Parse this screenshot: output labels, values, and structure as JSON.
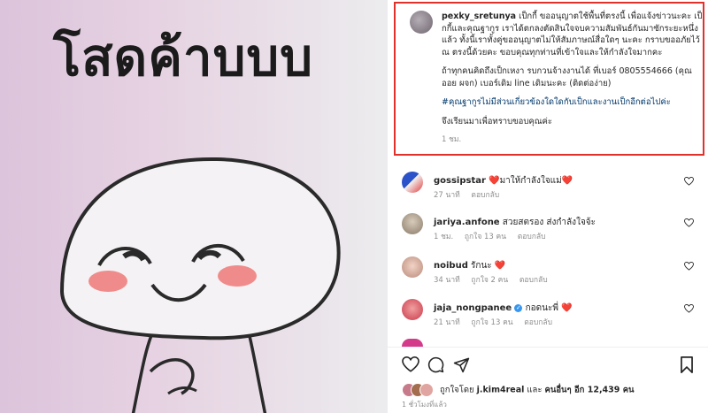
{
  "image": {
    "text": "โสดค้าบบบ"
  },
  "caption": {
    "username": "pexky_sretunya",
    "paragraphs": [
      "เป็กกี้ ขออนุญาตใช้พื้นที่ตรงนี้ เพื่อแจ้งข่าวนะคะ เป็กกี้และคุณฐากูร เราได้ตกลงตัดสินใจจบความสัมพันธ์กันมาซักระยะหนึ่งแล้ว ทั้งนี้เราทั้งคู่ขออนุญาตไม่ให้สัมภาษณ์สื่อใดๆ นะคะ กราบขออภัยไว้ ณ ตรงนี้ด้วยคะ ขอบคุณทุกท่านที่เข้าใจและให้กำลังใจมากคะ",
      "ถ้าทุกคนคิดถึงเป็กเหงา รบกวนจ้างงานได้ ที่เบอร์ 0805554666 (คุณออย ผจก) เบอร์เดิม line เดิมนะคะ (ติดต่อง่าย)"
    ],
    "tags": "#คุณฐากูรไม่มีส่วนเกี่ยวข้องใดใดกับเป็กและงานเป็กอีกต่อไปค่ะ",
    "closing": "จึงเรียนมาเพื่อทราบขอบคุณค่ะ",
    "time": "1 ชม."
  },
  "comments": [
    {
      "username": "gossipstar",
      "text": "❤️มาให้กำลังใจแม่❤️",
      "time": "27 นาที",
      "likes": "",
      "reply": "ตอบกลับ",
      "verified": false
    },
    {
      "username": "jariya.anfone",
      "text": "สวยสตรอง ส่งกำลังใจจ้ะ",
      "time": "1 ชม.",
      "likes": "ถูกใจ 13 คน",
      "reply": "ตอบกลับ",
      "verified": false
    },
    {
      "username": "noibud",
      "text": "รักนะ ❤️",
      "time": "34 นาที",
      "likes": "ถูกใจ 2 คน",
      "reply": "ตอบกลับ",
      "verified": false
    },
    {
      "username": "jaja_nongpanee",
      "text": "กอดนะพี่ ❤️",
      "time": "21 นาที",
      "likes": "ถูกใจ 13 คน",
      "reply": "ตอบกลับ",
      "verified": true
    }
  ],
  "actions": {
    "like": "heart-icon",
    "comment": "comment-icon",
    "share": "share-icon",
    "save": "bookmark-icon"
  },
  "likes": {
    "prefix": "ถูกใจโดย",
    "user": "j.kim4real",
    "middle": "และ",
    "others": "คนอื่นๆ อีก 12,439 คน"
  },
  "posted": "1 ชั่วโมงที่แล้ว",
  "colors": {
    "highlight_border": "#e0312b",
    "heart_red": "#ed2c2c",
    "link_blue": "#00376b",
    "verified_blue": "#3897f0"
  }
}
